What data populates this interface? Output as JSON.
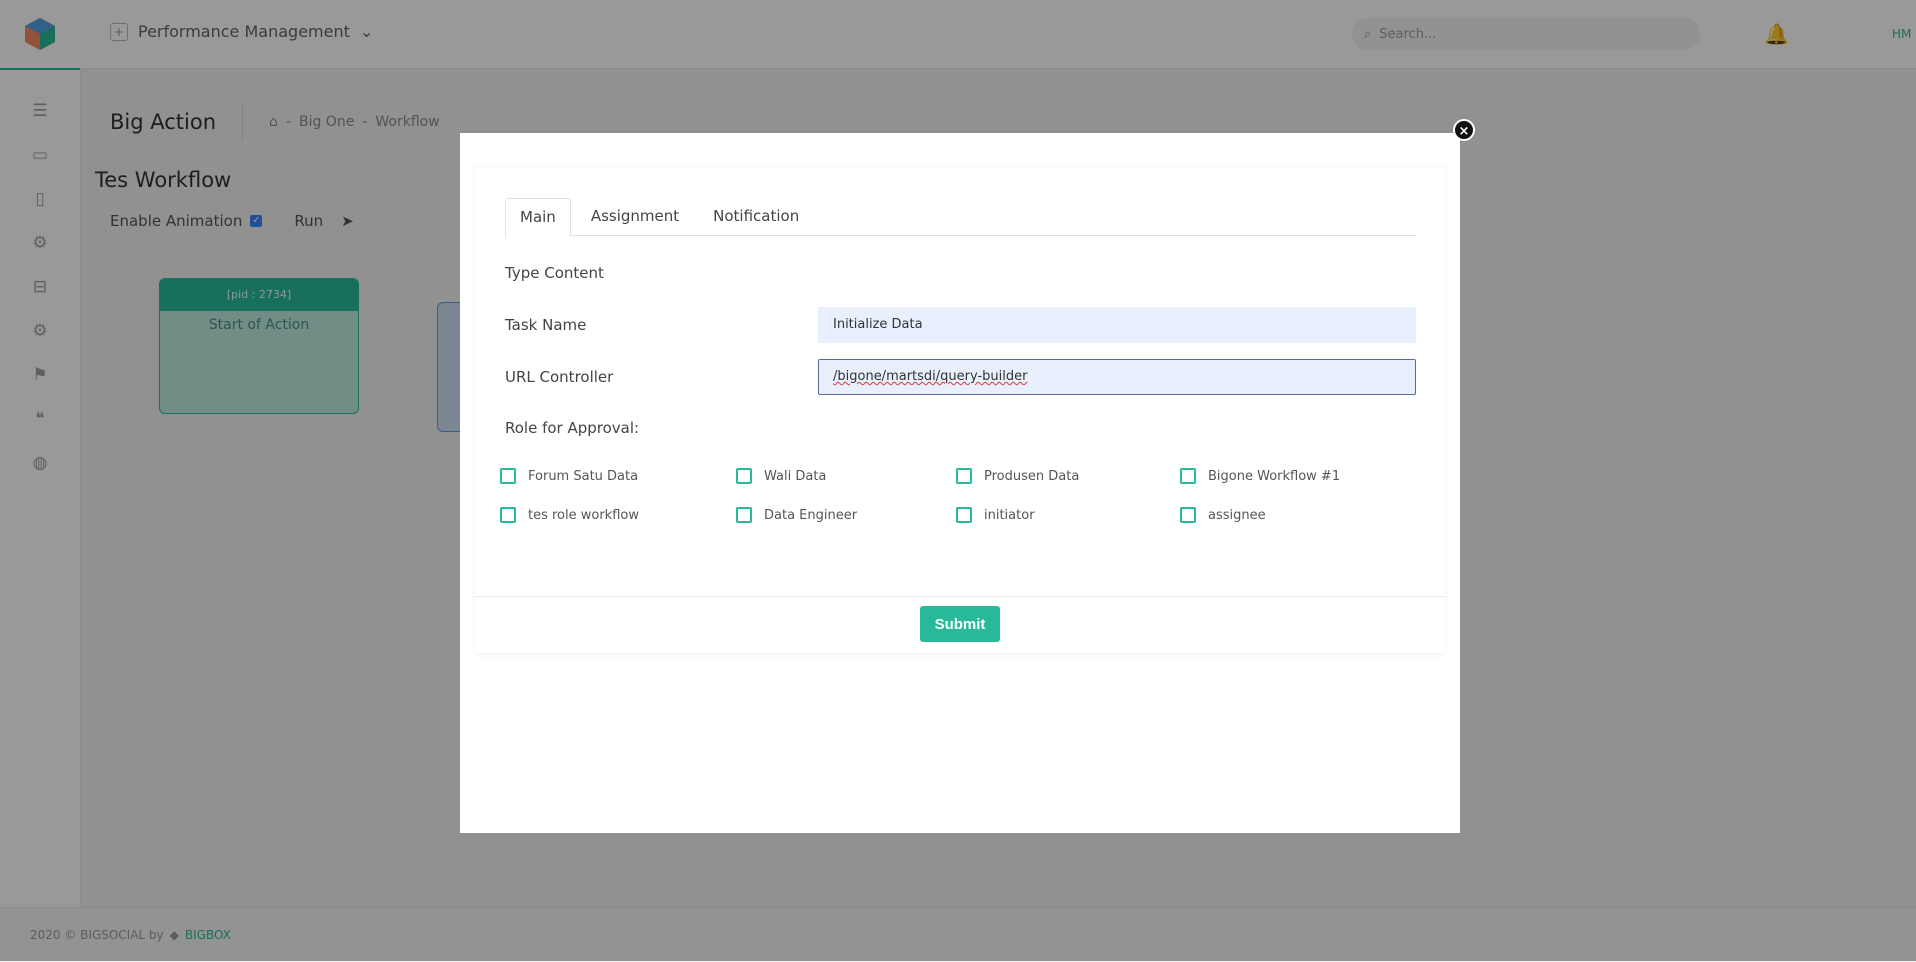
{
  "topbar": {
    "module_label": "Performance Management",
    "search_placeholder": "Search...",
    "user_initials": "HM"
  },
  "page": {
    "title": "Big Action",
    "breadcrumb": [
      "Big One",
      "Workflow"
    ]
  },
  "workflow": {
    "title": "Tes Workflow",
    "enable_animation_label": "Enable Animation",
    "enable_animation_checked": true,
    "run_label": "Run",
    "nodes": [
      {
        "pid": "[pid : 2734]",
        "label": "Start of Action"
      }
    ]
  },
  "footer": {
    "copyright": "2020 © BIGSOCIAL by",
    "brand": "BIGBOX"
  },
  "modal": {
    "tabs": [
      {
        "label": "Main",
        "active": true
      },
      {
        "label": "Assignment",
        "active": false
      },
      {
        "label": "Notification",
        "active": false
      }
    ],
    "type_content_label": "Type Content",
    "task_name_label": "Task Name",
    "task_name_value": "Initialize Data",
    "url_controller_label": "URL Controller",
    "url_controller_value": "/bigone/martsdi/query-builder",
    "role_label": "Role for Approval:",
    "roles": [
      {
        "label": "Forum Satu Data",
        "checked": false
      },
      {
        "label": "Wali Data",
        "checked": false
      },
      {
        "label": "Produsen Data",
        "checked": false
      },
      {
        "label": "Bigone Workflow #1",
        "checked": false
      },
      {
        "label": "tes role workflow",
        "checked": false
      },
      {
        "label": "Data Engineer",
        "checked": false
      },
      {
        "label": "initiator",
        "checked": false
      },
      {
        "label": "assignee",
        "checked": false
      }
    ],
    "submit_label": "Submit"
  },
  "colors": {
    "accent": "#27b99a",
    "overlay": "rgba(0,0,0,0.40)"
  }
}
